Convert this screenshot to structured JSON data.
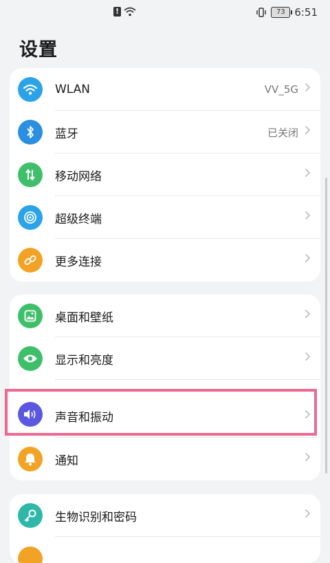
{
  "status_bar": {
    "battery": "73",
    "time": "6:51"
  },
  "page_title": "设置",
  "groups": [
    {
      "items": [
        {
          "label": "WLAN",
          "value": "VV_5G",
          "icon": "wifi-icon",
          "color": "#2aa3e8"
        },
        {
          "label": "蓝牙",
          "value": "已关闭",
          "icon": "bluetooth-icon",
          "color": "#2a8fe0"
        },
        {
          "label": "移动网络",
          "value": "",
          "icon": "mobile-data-icon",
          "color": "#3fbf6a"
        },
        {
          "label": "超级终端",
          "value": "",
          "icon": "super-device-icon",
          "color": "#2aa3e8"
        },
        {
          "label": "更多连接",
          "value": "",
          "icon": "link-icon",
          "color": "#f2a326"
        }
      ]
    },
    {
      "items": [
        {
          "label": "桌面和壁纸",
          "value": "",
          "icon": "wallpaper-icon",
          "color": "#3fbf6a"
        },
        {
          "label": "显示和亮度",
          "value": "",
          "icon": "eye-icon",
          "color": "#3fbf6a"
        },
        {
          "label": "声音和振动",
          "value": "",
          "icon": "volume-icon",
          "color": "#5b57e0"
        },
        {
          "label": "通知",
          "value": "",
          "icon": "bell-icon",
          "color": "#f2a326"
        }
      ]
    },
    {
      "items": [
        {
          "label": "生物识别和密码",
          "value": "",
          "icon": "key-icon",
          "color": "#2fb8a8"
        }
      ]
    }
  ]
}
